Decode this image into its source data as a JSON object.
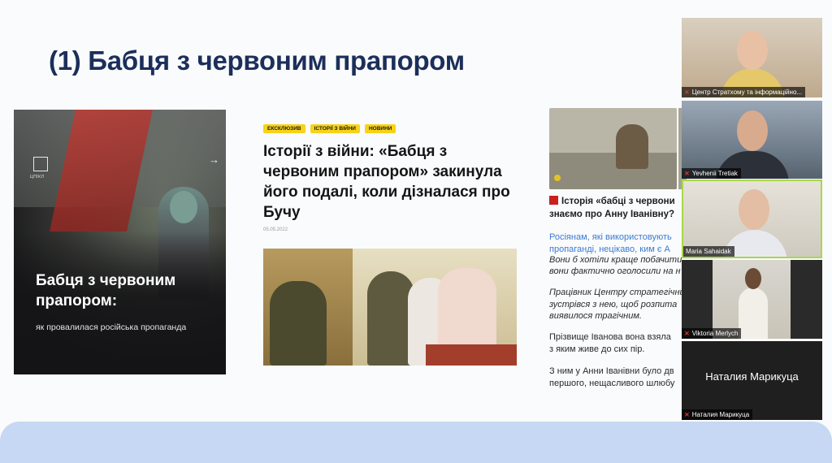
{
  "slide": {
    "title": "(1) Бабця з червоним прапором"
  },
  "poster": {
    "logo_text": "ЦПІКЛ",
    "arrow": "→",
    "title": "Бабця з червоним прапором:",
    "subtitle": "як провалилася російська пропаганда"
  },
  "article": {
    "tags": [
      "ЕКСКЛЮЗИВ",
      "ІСТОРІЇ З ВІЙНИ",
      "НОВИНИ"
    ],
    "title": "Історії з війни: «Бабця з червоним прапором» закинула його подалі, коли дізналася про Бучу",
    "date": "05.05.2022"
  },
  "right_article": {
    "heading_line1": "Історія «бабці з червони",
    "heading_line2": "знаємо про Анну Іванівну?",
    "lines": [
      {
        "text": "Росіянам, які використовують",
        "style": "link"
      },
      {
        "text": "пропаганді, нецікаво, ким є А",
        "style": "link"
      },
      {
        "text": "Вони б хотіли краще побачити",
        "style": "it"
      },
      {
        "text": "вони фактично оголосили на н",
        "style": "it"
      },
      {
        "text": "Працівник Центру стратегічни",
        "style": "it"
      },
      {
        "text": "зустрівся з нею, щоб розпита",
        "style": "it"
      },
      {
        "text": "виявилося трагічним.",
        "style": "it"
      },
      {
        "text": "Прізвище Іванова вона взяла",
        "style": "plain"
      },
      {
        "text": "з яким живе до сих пір.",
        "style": "plain"
      },
      {
        "text": "З ним у Анни Іванівни було дв",
        "style": "plain"
      },
      {
        "text": "першого, нещасливого шлюбу",
        "style": "plain"
      }
    ]
  },
  "participants": [
    {
      "name": "Центр Стратхому та інформаційно...",
      "muted": true
    },
    {
      "name": "Yevhenii Tretiak",
      "muted": true
    },
    {
      "name": "Maria Sahaidak",
      "muted": false,
      "active_speaker": true
    },
    {
      "name": "Viktoria Merlych",
      "muted": true
    },
    {
      "name": "Наталия Марикуца",
      "muted": true,
      "video_off": true
    }
  ],
  "colors": {
    "title": "#1c2f5b",
    "tag_bg": "#f7d318",
    "link": "#3b7bd3",
    "active_speaker_border": "#a8d84a",
    "bottom_bar": "#c6d8f3"
  }
}
